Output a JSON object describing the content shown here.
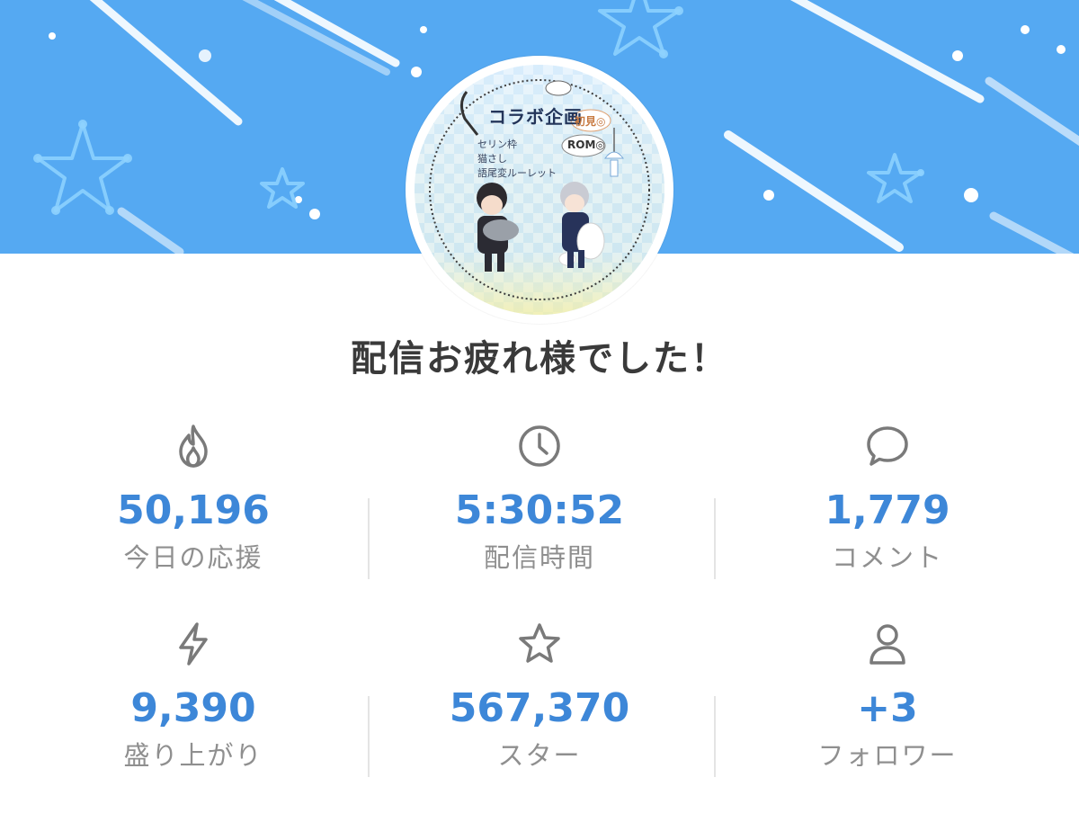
{
  "avatar": {
    "title": "コラボ企画",
    "notes": [
      "セリン枠",
      "猫さし",
      "語尾変ルーレット"
    ],
    "bubble_1": "初見◎",
    "bubble_2": "ROM◎"
  },
  "headline": "配信お疲れ様でした！",
  "stats": [
    {
      "icon": "fire-icon",
      "value": "50,196",
      "label": "今日の応援"
    },
    {
      "icon": "clock-icon",
      "value": "5:30:52",
      "label": "配信時間"
    },
    {
      "icon": "comment-icon",
      "value": "1,779",
      "label": "コメント"
    },
    {
      "icon": "lightning-icon",
      "value": "9,390",
      "label": "盛り上がり"
    },
    {
      "icon": "star-icon",
      "value": "567,370",
      "label": "スター"
    },
    {
      "icon": "person-icon",
      "value": "+3",
      "label": "フォロワー"
    }
  ],
  "colors": {
    "banner": "#55a9f2",
    "value": "#3d87d8",
    "label": "#8f8f8f",
    "icon": "#7a7a7a",
    "headline": "#3a3a3a"
  }
}
